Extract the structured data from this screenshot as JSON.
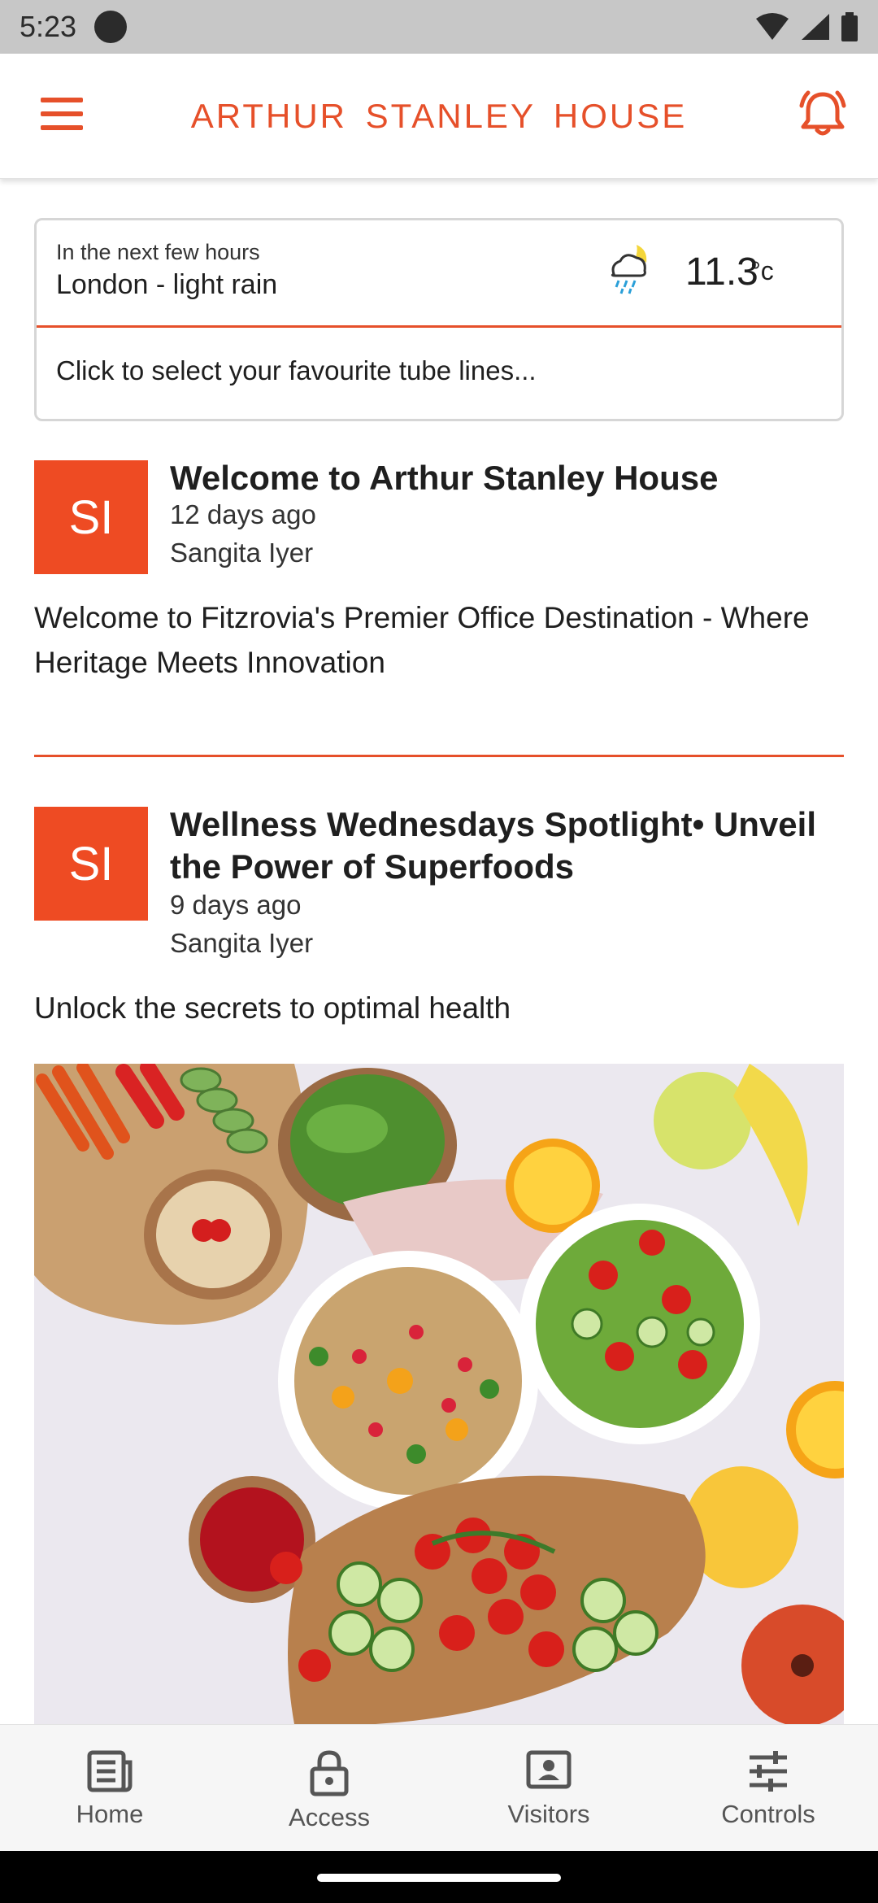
{
  "status": {
    "time": "5:23"
  },
  "header": {
    "title": "ARTHUR STANLEY HOUSE"
  },
  "weather": {
    "subtitle": "In the next few hours",
    "location": "London - light rain",
    "temperature": "11.3",
    "unit": "°c",
    "tube_prompt": "Click to select your favourite tube lines..."
  },
  "posts": [
    {
      "avatar": "SI",
      "title": "Welcome to Arthur Stanley House",
      "time": "12 days ago",
      "author": "Sangita Iyer",
      "body": "Welcome to Fitzrovia's Premier Office Destination - Where Heritage Meets Innovation"
    },
    {
      "avatar": "SI",
      "title": "Wellness Wednesdays Spotlight• Unveil the Power of Superfoods",
      "time": "9 days ago",
      "author": "Sangita Iyer",
      "body": "Unlock the secrets to optimal health"
    }
  ],
  "nav": [
    {
      "label": "Home",
      "icon": "news-icon"
    },
    {
      "label": "Access",
      "icon": "lock-icon"
    },
    {
      "label": "Visitors",
      "icon": "badge-icon"
    },
    {
      "label": "Controls",
      "icon": "sliders-icon"
    }
  ],
  "colors": {
    "accent": "#e6502a",
    "avatar": "#ee4b23"
  }
}
